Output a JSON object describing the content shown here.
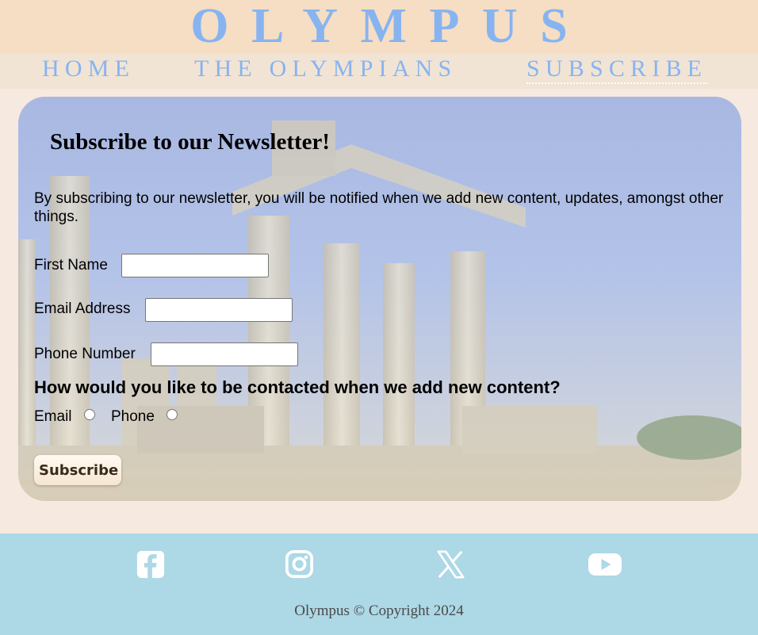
{
  "site": {
    "title": "OLYMPUS"
  },
  "nav": {
    "items": [
      {
        "label": "HOME",
        "active": false
      },
      {
        "label": "THE OLYMPIANS",
        "active": false
      },
      {
        "label": "SUBSCRIBE",
        "active": true
      }
    ]
  },
  "form": {
    "heading": "Subscribe to our Newsletter!",
    "intro": "By subscribing to our newsletter, you will be notified when we add new content, updates, amongst other things.",
    "fields": {
      "first_name": {
        "label": "First Name",
        "value": ""
      },
      "email": {
        "label": "Email Address",
        "value": ""
      },
      "phone": {
        "label": "Phone Number",
        "value": ""
      }
    },
    "contact_question": "How would you like to be contacted when we add new content?",
    "contact_options": [
      {
        "label": "Email",
        "checked": false
      },
      {
        "label": "Phone",
        "checked": false
      }
    ],
    "submit_label": "Subscribe"
  },
  "footer": {
    "social_icons": [
      "facebook-icon",
      "instagram-icon",
      "x-icon",
      "youtube-icon"
    ],
    "copyright": "Olympus © Copyright 2024"
  },
  "colors": {
    "brand_blue": "#87b4f0",
    "header_bg": "#f5dec4",
    "nav_bg": "#f1e4d5",
    "page_bg": "#f6e9df",
    "footer_bg": "#add8e6",
    "icon_white": "#ffffff"
  }
}
